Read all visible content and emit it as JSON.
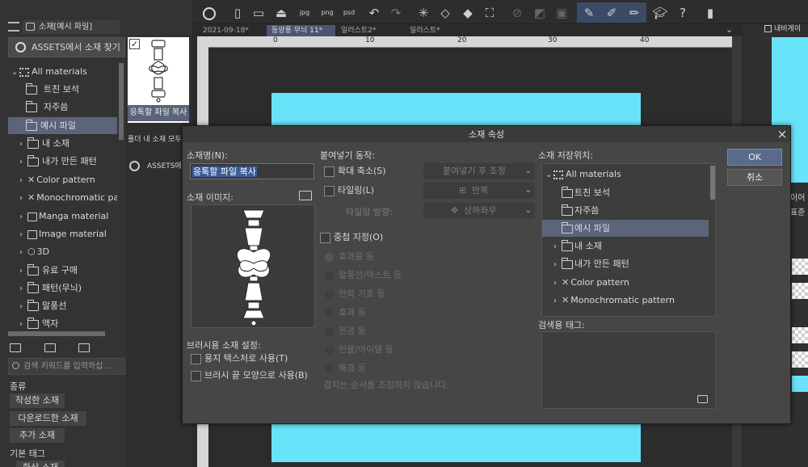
{
  "left_panel": {
    "tab_label": "소재[예시 파일]",
    "assets_button": "ASSETS에서 소재 찾기",
    "tree": [
      {
        "label": "All materials",
        "icon": "grid-icon",
        "expanded": true
      },
      {
        "label": "트친 보석",
        "icon": "folder-icon"
      },
      {
        "label": "자주씀",
        "icon": "folder-icon"
      },
      {
        "label": "예시 파일",
        "icon": "folder-icon",
        "selected": true
      },
      {
        "label": "내 소재",
        "icon": "folder-icon"
      },
      {
        "label": "내가 만든 패턴",
        "icon": "folder-icon"
      },
      {
        "label": "Color pattern",
        "icon": "palette-icon"
      },
      {
        "label": "Monochromatic patter",
        "icon": "cross-pattern-icon"
      },
      {
        "label": "Manga material",
        "icon": "manga-icon"
      },
      {
        "label": "Image material",
        "icon": "image-icon"
      },
      {
        "label": "3D",
        "icon": "cube-icon"
      },
      {
        "label": "유료 구매",
        "icon": "folder-icon"
      },
      {
        "label": "패턴(무늬)",
        "icon": "folder-icon"
      },
      {
        "label": "말풍선",
        "icon": "folder-icon"
      },
      {
        "label": "액자",
        "icon": "folder-icon"
      }
    ],
    "search_placeholder": "검색 키워드를 입력하십...",
    "category_label": "종류",
    "category_buttons": [
      "작성한 소재",
      "다운로드한 소재",
      "추가 소재"
    ],
    "basic_tag_label": "기본 태그",
    "basic_tag_button": "화상 소재",
    "thumb_label": "응톡할 파일 복사",
    "folder_text": "폴더 내 소재 모두",
    "assets_text": "ASSETS에서"
  },
  "toolbar": {
    "icons": [
      "logo-icon",
      "new-file-icon",
      "open-folder-icon",
      "cloud-upload-icon",
      "export-jpg-icon",
      "export-png-icon",
      "export-psd-icon",
      "undo-icon",
      "redo-icon",
      "loading-icon",
      "clear-icon",
      "fill-icon",
      "transform-icon",
      "deselect-icon",
      "invert-icon",
      "show-selection-icon",
      "pen-snap-icon",
      "brush-snap-icon",
      "ruler-snap-icon",
      "learn-icon",
      "help-icon",
      "companion-icon"
    ]
  },
  "canvas_tabs": [
    {
      "label": "2021-09-18*",
      "active": false
    },
    {
      "label": "동양풍 무늬 11*",
      "active": true
    },
    {
      "label": "일러스트2*",
      "active": false
    },
    {
      "label": "일러스트*",
      "active": false
    }
  ],
  "ruler": {
    "labels": [
      "0",
      "10",
      "20",
      "30",
      "40"
    ]
  },
  "right_panel": {
    "nav_tab": "내비게이",
    "layer_text_1": "이어",
    "layer_text_2": "표준"
  },
  "dialog": {
    "title": "소재 속성",
    "close": "×",
    "name_label": "소재명(N):",
    "name_value": "응톡할 파일 복사",
    "image_label": "소재 이미지:",
    "brush_settings_label": "브러시용 소재 설정:",
    "paper_texture": "용지 텍스처로 사용(T)",
    "brush_tip": "브러시 끝 모양으로 사용(B)",
    "paste_label": "붙여넣기 동작:",
    "scale_label": "확대 축소(S)",
    "scale_dropdown": "붙여넣기 후 조정",
    "tiling_label": "타일링(L)",
    "tiling_dropdown": "반복",
    "tiling_dir_label": "타일링 방향:",
    "tiling_dir_dropdown": "상하좌우",
    "overlap_label": "중첩 지정(O)",
    "overlap_options": [
      "효과음 등",
      "말풍선/텍스트 등",
      "만화 기호 등",
      "효과 등",
      "전경 등",
      "인물/아이템 등",
      "배경 등"
    ],
    "overlap_note": "겹치는 순서를 조정하지 않습니다.",
    "location_label": "소재 저장위치:",
    "location_tree": [
      {
        "label": "All materials",
        "icon": "grid-icon"
      },
      {
        "label": "트친 보석",
        "icon": "folder-icon"
      },
      {
        "label": "자주씀",
        "icon": "folder-icon"
      },
      {
        "label": "예시 파일",
        "icon": "folder-icon",
        "selected": true
      },
      {
        "label": "내 소재",
        "icon": "folder-icon"
      },
      {
        "label": "내가 만든 패턴",
        "icon": "folder-icon"
      },
      {
        "label": "Color pattern",
        "icon": "palette-icon"
      },
      {
        "label": "Monochromatic pattern",
        "icon": "cross-pattern-icon"
      }
    ],
    "search_tag_label": "검색용 태그:",
    "ok": "OK",
    "cancel": "취소"
  },
  "colors": {
    "canvas_cyan": "#69e3f9",
    "selection": "#5b6478",
    "ok_button": "#5a6a8a"
  }
}
